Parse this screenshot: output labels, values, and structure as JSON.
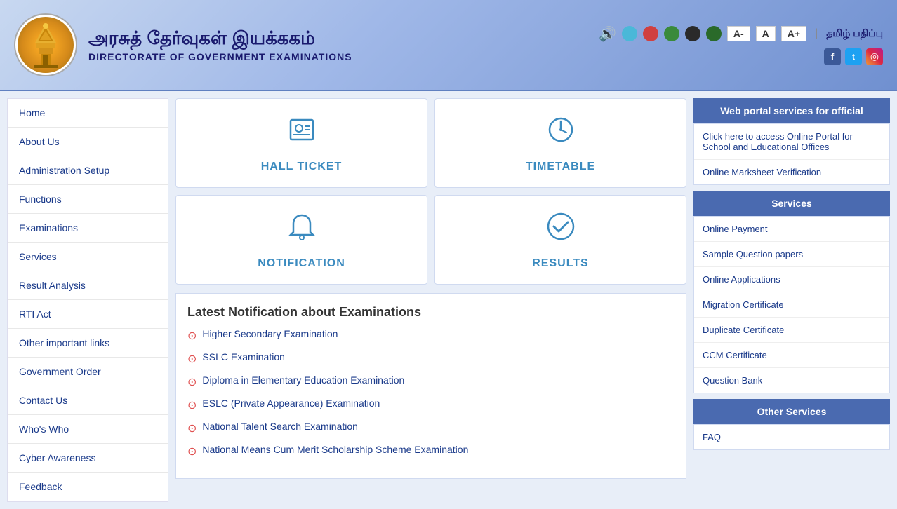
{
  "header": {
    "title_tamil": "அரசுத் தேர்வுகள் இயக்ககம்",
    "title_english": "DIRECTORATE OF GOVERNMENT EXAMINATIONS",
    "controls": {
      "sound_label": "🔊",
      "font_small": "A-",
      "font_normal": "A",
      "font_large": "A+",
      "tamil_print": "தமிழ் பதிப்பு"
    },
    "colors": [
      "#4ab8d8",
      "#d04040",
      "#3a8a3a",
      "#2a2a2a",
      "#2a6a2a"
    ],
    "social": {
      "facebook": "f",
      "twitter": "t",
      "instagram": "i"
    }
  },
  "sidebar": {
    "items": [
      {
        "label": "Home",
        "name": "home"
      },
      {
        "label": "About Us",
        "name": "about-us"
      },
      {
        "label": "Administration Setup",
        "name": "administration-setup"
      },
      {
        "label": "Functions",
        "name": "functions"
      },
      {
        "label": "Examinations",
        "name": "examinations"
      },
      {
        "label": "Services",
        "name": "services"
      },
      {
        "label": "Result Analysis",
        "name": "result-analysis"
      },
      {
        "label": "RTI Act",
        "name": "rti-act"
      },
      {
        "label": "Other important links",
        "name": "other-important-links"
      },
      {
        "label": "Government Order",
        "name": "government-order"
      },
      {
        "label": "Contact Us",
        "name": "contact-us"
      },
      {
        "label": "Who's Who",
        "name": "whos-who"
      },
      {
        "label": "Cyber Awareness",
        "name": "cyber-awareness"
      },
      {
        "label": "Feedback",
        "name": "feedback"
      }
    ]
  },
  "cards": [
    {
      "label": "HALL TICKET",
      "icon": "🪪",
      "name": "hall-ticket"
    },
    {
      "label": "TIMETABLE",
      "icon": "🕐",
      "name": "timetable"
    },
    {
      "label": "NOTIFICATION",
      "icon": "🔔",
      "name": "notification"
    },
    {
      "label": "RESULTS",
      "icon": "✅",
      "name": "results"
    }
  ],
  "notifications": {
    "title": "Latest Notification about Examinations",
    "items": [
      "Higher Secondary Examination",
      "SSLC Examination",
      "Diploma in Elementary Education Examination",
      "ESLC (Private Appearance) Examination",
      "National Talent Search Examination",
      "National Means Cum Merit Scholarship Scheme Examination"
    ]
  },
  "web_portal": {
    "header": "Web portal services for official",
    "links": [
      "Click here to access Online Portal for School and Educational Offices",
      "Online Marksheet Verification"
    ]
  },
  "services": {
    "header": "Services",
    "items": [
      "Online Payment",
      "Sample Question papers",
      "Online Applications",
      "Migration Certificate",
      "Duplicate Certificate",
      "CCM Certificate",
      "Question Bank"
    ]
  },
  "other_services": {
    "header": "Other Services",
    "items": [
      "FAQ"
    ]
  }
}
